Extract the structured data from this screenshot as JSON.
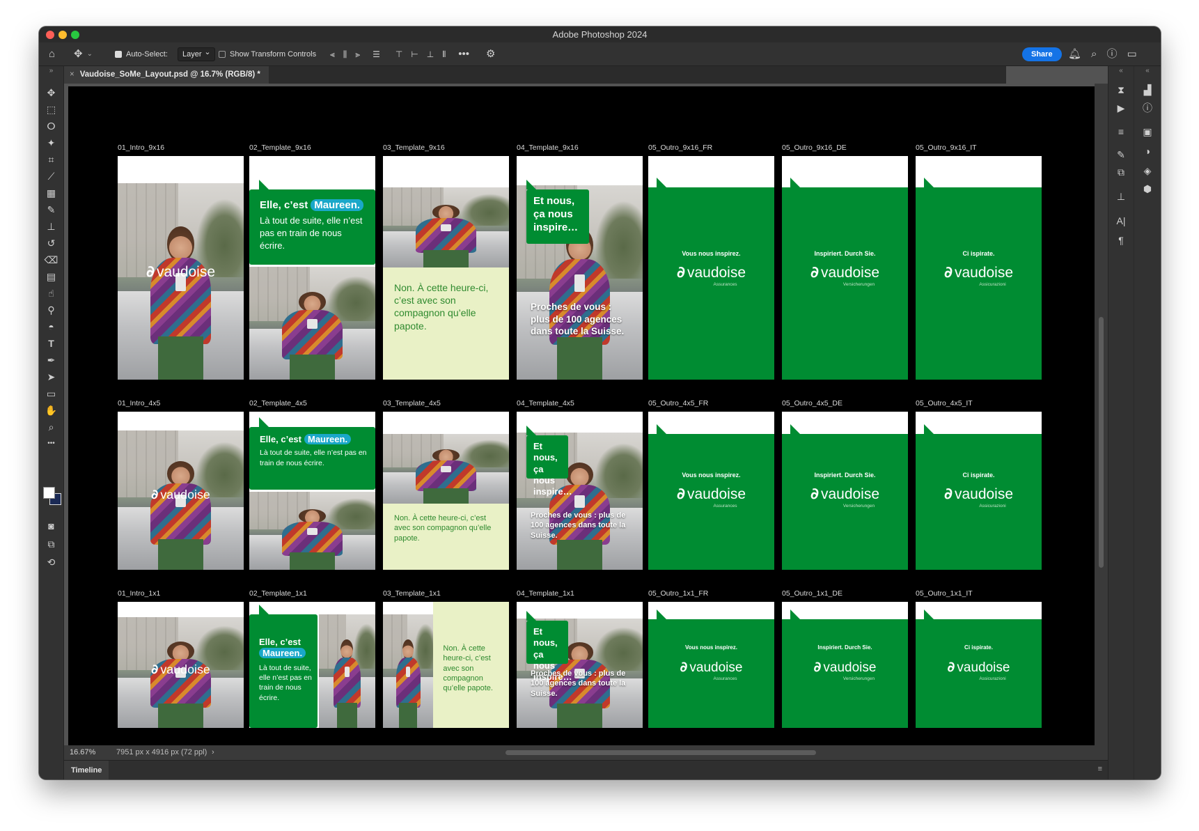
{
  "app": {
    "title": "Adobe Photoshop 2024"
  },
  "options_bar": {
    "auto_select_label": "Auto-Select:",
    "auto_select_target": "Layer",
    "show_transform_label": "Show Transform Controls",
    "share_label": "Share"
  },
  "document": {
    "tab_title": "Vaudoise_SoMe_Layout.psd @ 16.7% (RGB/8) *"
  },
  "status": {
    "zoom": "16.67%",
    "dimensions": "7951 px x 4916 px (72 ppl)"
  },
  "timeline": {
    "label": "Timeline"
  },
  "brand": {
    "logo_text": "vaudoise",
    "green": "#008c32",
    "highlight": "#1aa8c9",
    "paper": "#e9f1c6"
  },
  "artboards": {
    "row1": [
      {
        "label": "01_Intro_9x16"
      },
      {
        "label": "02_Template_9x16",
        "line1": "Elle, c’est",
        "name": "Maureen.",
        "body": "Là tout de suite, elle n’est pas en train de nous écrire."
      },
      {
        "label": "03_Template_9x16",
        "text": "Non. À cette heure-ci, c’est avec son compagnon qu’elle papote."
      },
      {
        "label": "04_Template_9x16",
        "bubble": "Et nous, ça nous inspire…",
        "caption": "Proches de vous : plus de 100 agences dans toute la Suisse."
      },
      {
        "label": "05_Outro_9x16_FR",
        "tagline": "Vous nous inspirez.",
        "sub": "Assurances"
      },
      {
        "label": "05_Outro_9x16_DE",
        "tagline": "Inspiriert. Durch Sie.",
        "sub": "Versicherungen"
      },
      {
        "label": "05_Outro_9x16_IT",
        "tagline": "Ci ispirate.",
        "sub": "Assicurazioni"
      }
    ],
    "row2": [
      {
        "label": "01_Intro_4x5"
      },
      {
        "label": "02_Template_4x5",
        "line1": "Elle, c’est",
        "name": "Maureen.",
        "body": "Là tout de suite, elle n’est pas en train de nous écrire."
      },
      {
        "label": "03_Template_4x5",
        "text": "Non. À cette heure-ci, c’est avec son compagnon qu’elle papote."
      },
      {
        "label": "04_Template_4x5",
        "bubble": "Et nous, ça nous inspire…",
        "caption": "Proches de vous : plus de 100 agences dans toute la Suisse."
      },
      {
        "label": "05_Outro_4x5_FR",
        "tagline": "Vous nous inspirez.",
        "sub": "Assurances"
      },
      {
        "label": "05_Outro_4x5_DE",
        "tagline": "Inspiriert. Durch Sie.",
        "sub": "Versicherungen"
      },
      {
        "label": "05_Outro_4x5_IT",
        "tagline": "Ci ispirate.",
        "sub": "Assicurazioni"
      }
    ],
    "row3": [
      {
        "label": "01_Intro_1x1"
      },
      {
        "label": "02_Template_1x1",
        "line1": "Elle, c’est",
        "name": "Maureen.",
        "body": "Là tout de suite, elle n’est pas en train de nous écrire."
      },
      {
        "label": "03_Template_1x1",
        "text": "Non. À cette heure-ci, c’est avec son compagnon qu’elle papote."
      },
      {
        "label": "04_Template_1x1",
        "bubble": "Et nous, ça nous inspire…",
        "caption": "Proches de vous : plus de 100 agences dans toute la Suisse."
      },
      {
        "label": "05_Outro_1x1_FR",
        "tagline": "Vous nous inspirez.",
        "sub": "Assurances"
      },
      {
        "label": "05_Outro_1x1_DE",
        "tagline": "Inspiriert. Durch Sie.",
        "sub": "Versicherungen"
      },
      {
        "label": "05_Outro_1x1_IT",
        "tagline": "Ci ispirate.",
        "sub": "Assicurazioni"
      }
    ]
  },
  "icons": {
    "tools": [
      "move-icon",
      "marquee-icon",
      "lasso-icon",
      "magic-wand-icon",
      "crop-icon",
      "eyedropper-icon",
      "patch-icon",
      "brush-icon",
      "stamp-icon",
      "history-brush-icon",
      "eraser-icon",
      "gradient-icon",
      "smudge-icon",
      "dodge-icon",
      "pen-fill-icon",
      "type-icon",
      "pen-icon",
      "path-select-icon",
      "rectangle-icon",
      "hand-icon",
      "zoom-icon",
      "more-icon"
    ],
    "right": [
      "history-icon",
      "play-icon",
      "adjustments-icon",
      "brush-settings-icon",
      "properties-icon",
      "stamp-icon",
      "character-icon",
      "paragraph-icon",
      "histogram-icon",
      "info-icon",
      "libraries-icon",
      "color-icon",
      "layers-icon",
      "channels-icon"
    ]
  }
}
